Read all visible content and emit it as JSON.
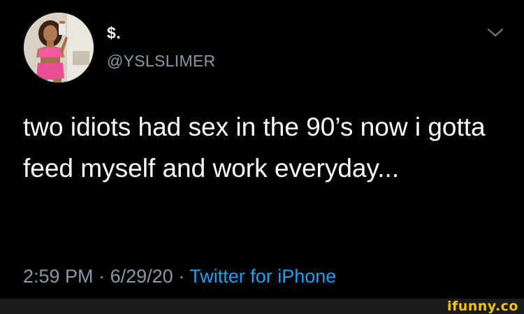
{
  "tweet": {
    "display_name": "$.",
    "handle": "@YSLSLIMER",
    "text": "two idiots had sex in the 90’s now i gotta feed myself and work everyday...",
    "time": "2:59 PM",
    "separator1": "·",
    "date": "6/29/20",
    "separator2": "·",
    "source": "Twitter for iPhone"
  },
  "icons": {
    "avatar": "profile-photo",
    "menu": "chevron-down-icon"
  },
  "watermark": {
    "text": "ifunny.co"
  },
  "colors": {
    "background": "#000000",
    "text": "#ffffff",
    "secondary_text": "#8b98a5",
    "link": "#1da1f2",
    "watermark": "#f5c400"
  }
}
